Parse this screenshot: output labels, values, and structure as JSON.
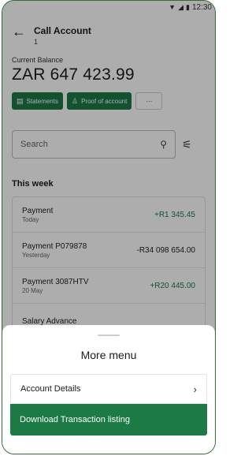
{
  "status_bar": {
    "time": "12:30"
  },
  "header": {
    "title": "Call Account",
    "subtitle": "1"
  },
  "balance": {
    "label": "Current Balance",
    "value": "ZAR 647 423.99"
  },
  "actions": [
    {
      "label": "Statements",
      "icon": "document-icon"
    },
    {
      "label": "Proof of account",
      "icon": "person-icon"
    },
    {
      "label": "···",
      "icon": "more-icon"
    }
  ],
  "search": {
    "placeholder": "Search"
  },
  "section": {
    "title": "This week"
  },
  "transactions": [
    {
      "name": "Payment",
      "date": "Today",
      "amount": "+R1 345.45"
    },
    {
      "name": "Payment P079878",
      "date": "Yesterday",
      "amount": "-R34 098 654.00"
    },
    {
      "name": "Payment 3087HTV",
      "date": "20 May",
      "amount": "+R20 445.00"
    },
    {
      "name": "Salary Advance",
      "date": "",
      "amount": ""
    }
  ],
  "sheet": {
    "title": "More menu",
    "item": "Account Details",
    "cta": "Download Transaction listing"
  },
  "colors": {
    "accent": "#1c7a45",
    "frame": "#2f6b3d"
  }
}
